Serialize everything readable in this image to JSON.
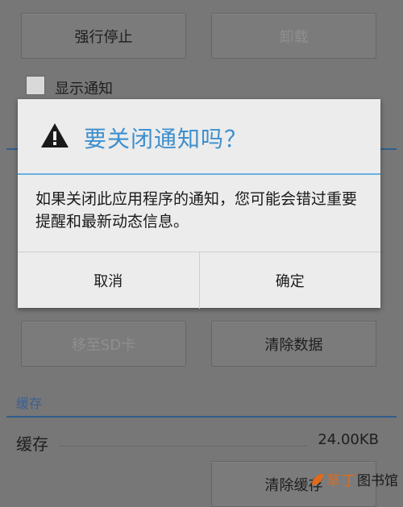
{
  "app_buttons": {
    "force_stop": "强行停止",
    "uninstall": "卸载",
    "move_to_sd": "移至SD卡",
    "clear_data": "清除数据",
    "clear_cache": "清除缓存"
  },
  "notifications": {
    "checkbox_label": "显示通知",
    "checked": false
  },
  "cache": {
    "section_title": "缓存",
    "label": "缓存",
    "value": "24.00KB"
  },
  "dialog": {
    "title": "要关闭通知吗？",
    "message": "如果关闭此应用程序的通知，您可能会错过重要提醒和最新动态信息。",
    "cancel": "取消",
    "ok": "确定",
    "accent_color": "#3d8fce"
  },
  "watermark": {
    "part1": "草",
    "part2": "丁",
    "part3": "图书馆"
  }
}
